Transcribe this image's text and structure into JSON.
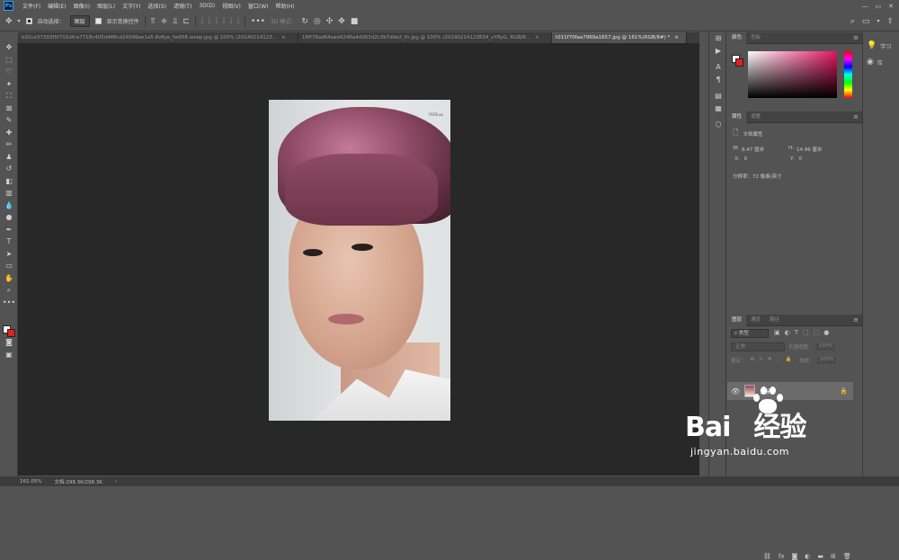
{
  "app": {
    "logo": "Ps"
  },
  "menu": [
    "文件(F)",
    "编辑(E)",
    "图像(I)",
    "图层(L)",
    "文字(Y)",
    "选择(S)",
    "滤镜(T)",
    "3D(D)",
    "视图(V)",
    "窗口(W)",
    "帮助(H)"
  ],
  "options": {
    "auto_select_label": "自动选择：",
    "auto_select_value": "图层",
    "show_transform_label": "显示变换控件",
    "mode_3d_label": "3D 模式："
  },
  "tabs": [
    {
      "title": "b92ca37393f5f715dfca7718c405d488cd24596ee1a5-8z8ye_fw658.webp.jpg @ 100% (20140214123...",
      "close": "×"
    },
    {
      "title": "16ff78ad64aed4246a4d063d2c3b7dde2_th.jpg @ 100% (20140214123834_uYRyG, RGB/8...",
      "close": "×"
    },
    {
      "title": "t011f70faa7969a1657.jpg @ 161%(RGB/8#) *",
      "close": "×"
    }
  ],
  "doc_caption": "FAFB.oo",
  "color_panel": {
    "tab1": "颜色",
    "tab2": "色板"
  },
  "properties_panel": {
    "tab1": "属性",
    "tab2": "调整",
    "section": "文档属性",
    "w_label": "W:",
    "w_value": "8.47 厘米",
    "h_label": "H:",
    "h_value": "14.96 厘米",
    "x_label": "X:",
    "x_value": "0",
    "y_label": "Y:",
    "y_value": "0",
    "resolution": "分辨率：72 像素/英寸"
  },
  "layers_panel": {
    "tab1": "图层",
    "tab2": "通道",
    "tab3": "路径",
    "kind": "类型",
    "blend": "正常",
    "opacity_label": "不透明度：",
    "opacity_value": "100%",
    "lock_label": "锁定：",
    "fill_label": "填充：",
    "fill_value": "100%",
    "layer_name": "背景"
  },
  "right_strip": {
    "learn": "学习",
    "library": "库"
  },
  "status": {
    "zoom": "161.05%",
    "doc": "文档:298.3K/298.3K",
    "arrow": "›"
  },
  "watermark": {
    "logo_left": "Bai",
    "logo_right": "经验",
    "url": "jingyan.baidu.com"
  }
}
